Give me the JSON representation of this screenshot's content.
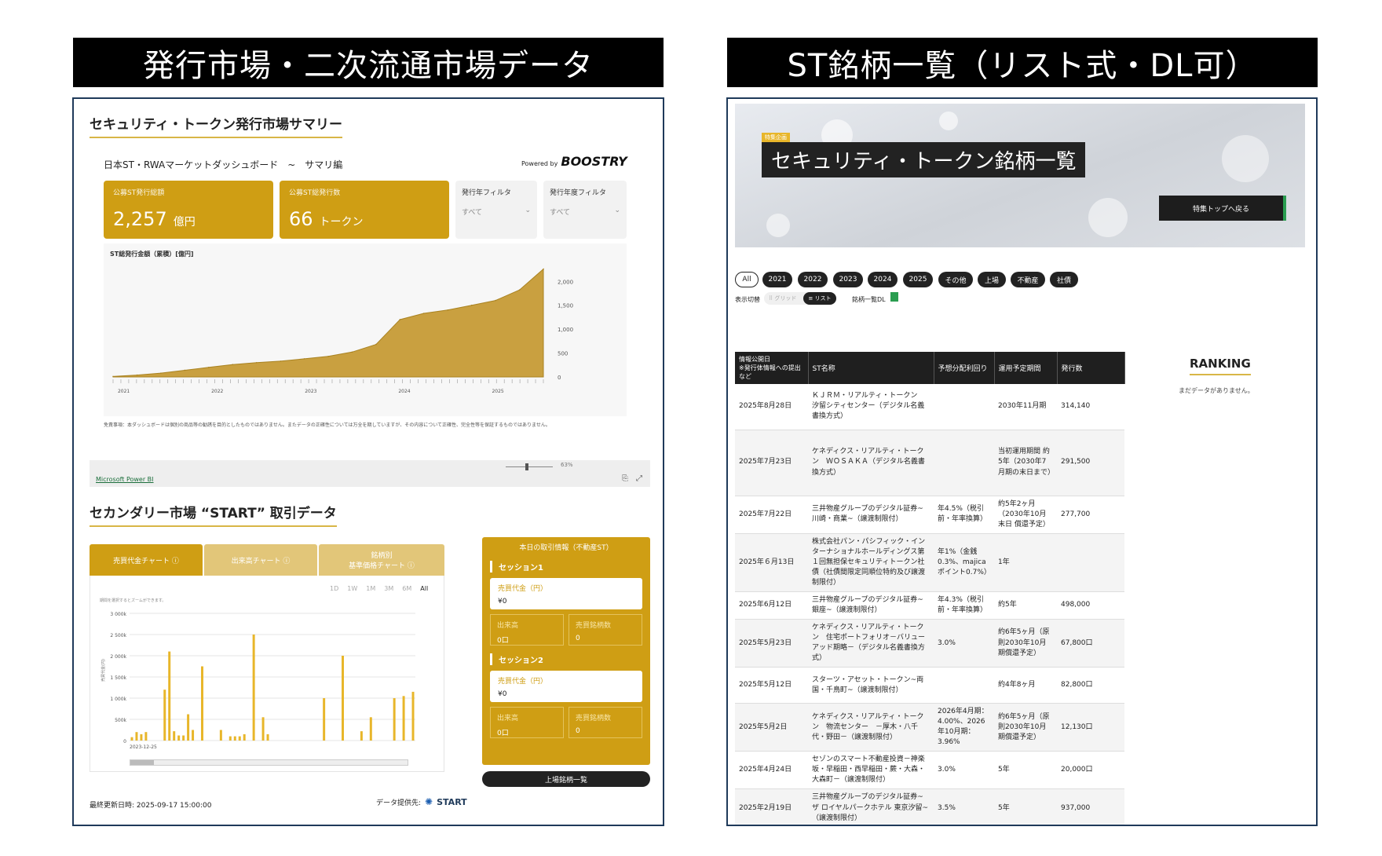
{
  "headers": {
    "left": "発行市場・二次流通市場データ",
    "right": "ST銘柄一覧（リスト式・DL可）"
  },
  "issuance": {
    "section_title": "セキュリティ・トークン発行市場サマリー",
    "dashboard_title": "日本ST・RWAマーケットダッシュボード　~　サマリ編",
    "powered_by": "Powered by",
    "brand": "BOOSTRY",
    "kpi1": {
      "label": "公募ST発行総額",
      "value": "2,257",
      "unit": "億円"
    },
    "kpi2": {
      "label": "公募ST総発行数",
      "value": "66",
      "unit": "トークン"
    },
    "filter1": {
      "label": "発行年フィルタ",
      "value": "すべて"
    },
    "filter2": {
      "label": "発行年度フィルタ",
      "value": "すべて"
    },
    "disclaimer": "免責事項：本ダッシュボードは個別の商品等の勧誘を目的としたものではありません。またデータの正確性については万全を期していますが、その内容について正確性、完全性等を保証するものではありません。",
    "zoom": "63%",
    "powerbi_link": "Microsoft Power BI"
  },
  "chart_data": [
    {
      "type": "area",
      "title": "ST総発行金額（累積）[億円]",
      "x_ticks": [
        "2021",
        "2022",
        "2023",
        "2024",
        "2025"
      ],
      "y_ticks": [
        "0",
        "500",
        "1,000",
        "1,500",
        "2,000"
      ],
      "ylim": [
        0,
        2300
      ],
      "x": [
        "2021-Q1",
        "2021-Q2",
        "2021-Q3",
        "2021-Q4",
        "2022-Q1",
        "2022-Q2",
        "2022-Q3",
        "2022-Q4",
        "2023-Q1",
        "2023-Q2",
        "2023-Q3",
        "2023-Q4",
        "2024-Q1",
        "2024-Q2",
        "2024-Q3",
        "2024-Q4",
        "2025-Q1",
        "2025-Q2",
        "2025-Q3"
      ],
      "values": [
        10,
        40,
        80,
        140,
        200,
        260,
        300,
        330,
        380,
        430,
        520,
        680,
        1200,
        1330,
        1400,
        1500,
        1600,
        1820,
        2257
      ],
      "color": "#c9a040"
    },
    {
      "type": "bar",
      "title": "売買代金チャート",
      "ylabel": "売買代金(円)",
      "hint": "期間を選択するとズームができます。",
      "y_ticks": [
        "0",
        "500k",
        "1 000k",
        "1 500k",
        "2 000k",
        "2 500k",
        "3 000k"
      ],
      "ylim": [
        0,
        3000000
      ],
      "x_start_label": "2023-12-25",
      "values": [
        80000,
        200000,
        150000,
        200000,
        0,
        0,
        0,
        1200000,
        2100000,
        220000,
        120000,
        120000,
        620000,
        250000,
        0,
        1750000,
        0,
        0,
        0,
        250000,
        0,
        100000,
        100000,
        100000,
        150000,
        0,
        2500000,
        0,
        550000,
        150000,
        0,
        0,
        0,
        0,
        0,
        0,
        0,
        0,
        0,
        0,
        0,
        1000000,
        0,
        0,
        0,
        2000000,
        0,
        0,
        0,
        220000,
        0,
        550000,
        0,
        0,
        0,
        0,
        1000000,
        0,
        1050000,
        0,
        1150000
      ],
      "color": "#e8b62a"
    }
  ],
  "secondary": {
    "section_title": "セカンダリー市場 “START” 取引データ",
    "tabs": [
      "売買代金チャート ⓘ",
      "出来高チャート ⓘ",
      "銘柄別\n基準価格チャート ⓘ"
    ],
    "ranges": [
      "1D",
      "1W",
      "1M",
      "3M",
      "6M",
      "All"
    ],
    "trade_title": "本日の取引情報（不動産ST）",
    "session1": "セッション1",
    "session2": "セッション2",
    "amount_label": "売買代金（円）",
    "amount_value": "¥0",
    "volume_label": "出来高",
    "volume_value": "0口",
    "count_label": "売買銘柄数",
    "count_value": "0",
    "list_button": "上場銘柄一覧",
    "updated": "最終更新日時: 2025-09-17 15:00:00",
    "provider": "データ提供先:",
    "provider_brand": "START"
  },
  "right": {
    "badge": "特集企画",
    "banner_title": "セキュリティ・トークン銘柄一覧",
    "back_button": "特集トップへ戻る",
    "filters": [
      "All",
      "2021",
      "2022",
      "2023",
      "2024",
      "2025",
      "その他",
      "上場",
      "不動産",
      "社債"
    ],
    "view_label": "表示切替",
    "grid_label": "⠿ グリッド",
    "list_label": "≡ リスト",
    "download_label": "銘柄一覧DL",
    "ranking_title": "RANKING",
    "ranking_empty": "まだデータがありません。",
    "table": {
      "headers": [
        "情報公開日\n※発行体情報への提出など",
        "ST名称",
        "予想分配利回り",
        "運用予定期間",
        "発行数"
      ],
      "rows": [
        [
          "2025年8月28日",
          "ＫＪＲＭ・リアルティ・トークン　汐留シティセンター（デジタル名義書換方式）",
          "",
          "2030年11月期",
          "314,140"
        ],
        [
          "2025年7月23日",
          "ケネディクス・リアルティ・トークン　ＷＯＳＡＫＡ（デジタル名義書換方式）",
          "",
          "当初運用期間 約5年（2030年7月期の末日まで）",
          "291,500"
        ],
        [
          "2025年7月22日",
          "三井物産グループのデジタル証券~川崎・商業~（譲渡制限付）",
          "年4.5%（税引前・年率換算）",
          "約5年2ヶ月（2030年10月末日 償還予定）",
          "277,700"
        ],
        [
          "2025年６月13日",
          "株式会社パン・パシフィック・インターナショナルホールディングス第１回無担保セキュリティトークン社債（社債間限定同順位特約及び譲渡制限付）",
          "年1%（金銭0.3%、majicaポイント0.7%）",
          "1年",
          ""
        ],
        [
          "2025年6月12日",
          "三井物産グループのデジタル証券~銀座~（譲渡制限付）",
          "年4.3%（税引前・年率換算）",
          "約5年",
          "498,000"
        ],
        [
          "2025年5月23日",
          "ケネディクス・リアルティ・トークン　住宅ポートフォリオ－バリューアッド期略－（デジタル名義書換方式）",
          "3.0%",
          "約6年5ヶ月（原則2030年10月期償還予定）",
          "67,800口"
        ],
        [
          "2025年5月12日",
          "スターツ・アセット・トークン~両国・千鳥町~（譲渡制限付）",
          "",
          "約4年8ヶ月",
          "82,800口"
        ],
        [
          "2025年5月2日",
          "ケネディクス・リアルティ・トークン　物流センター　－厚木・八千代・野田－（譲渡制限付）",
          "2026年4月期：4.00%、2026年10月期：3.96%",
          "約6年5ヶ月（原則2030年10月期償還予定）",
          "12,130口"
        ],
        [
          "2025年4月24日",
          "セゾンのスマート不動産投資－神楽坂・早稲田・西早稲田・蕨・大森・大森町－（譲渡制限付）",
          "3.0%",
          "5年",
          "20,000口"
        ],
        [
          "2025年2月19日",
          "三井物産グループのデジタル証券~ザ ロイヤルパークホテル 東京汐留~（譲渡制限付）",
          "3.5%",
          "5年",
          "937,000"
        ]
      ]
    }
  }
}
